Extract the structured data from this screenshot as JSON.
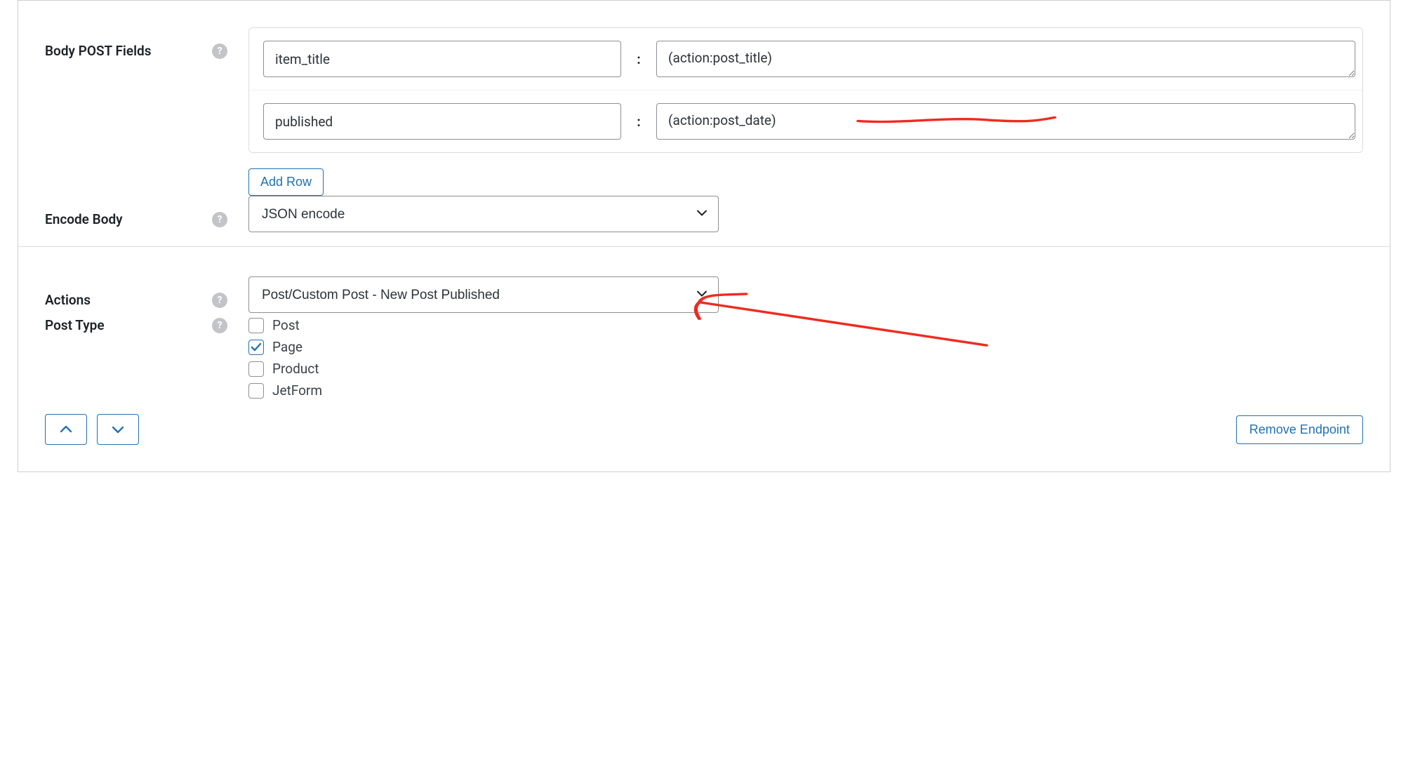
{
  "body_post_fields": {
    "label": "Body POST Fields",
    "rows": [
      {
        "key": "item_title",
        "sep": ":",
        "value": "(action:post_title)"
      },
      {
        "key": "published",
        "sep": ":",
        "value": "(action:post_date)"
      }
    ],
    "add_row_label": "Add Row"
  },
  "encode_body": {
    "label": "Encode Body",
    "selected": "JSON encode"
  },
  "actions": {
    "label": "Actions",
    "selected": "Post/Custom Post - New Post Published"
  },
  "post_type": {
    "label": "Post Type",
    "options": [
      {
        "label": "Post",
        "checked": false
      },
      {
        "label": "Page",
        "checked": true
      },
      {
        "label": "Product",
        "checked": false
      },
      {
        "label": "JetForm",
        "checked": false
      }
    ]
  },
  "footer": {
    "remove_label": "Remove Endpoint"
  },
  "help_glyph": "?"
}
